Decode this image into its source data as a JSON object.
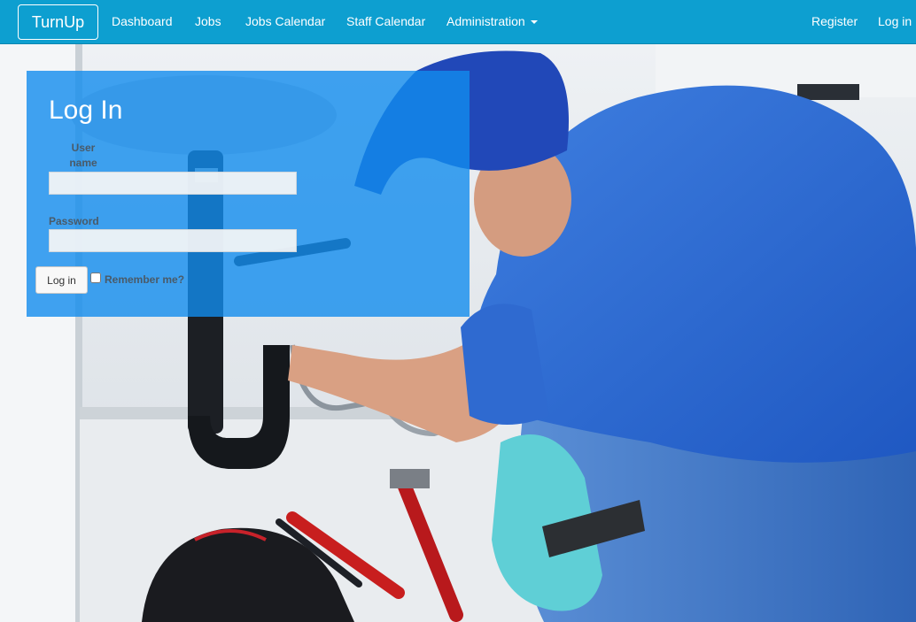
{
  "navbar": {
    "brand": "TurnUp",
    "links": {
      "dashboard": "Dashboard",
      "jobs": "Jobs",
      "jobs_calendar": "Jobs Calendar",
      "staff_calendar": "Staff Calendar",
      "administration": "Administration"
    },
    "register": "Register",
    "login": "Log in"
  },
  "login_form": {
    "title": "Log In",
    "username_label": "User name",
    "username_value": "",
    "password_label": "Password",
    "password_value": "",
    "submit_label": "Log in",
    "remember_label": "Remember me?",
    "remember_checked": false
  },
  "colors": {
    "navbar": "#0d9fd0",
    "panel": "#128cee",
    "background_scene": "#e4e8ec"
  }
}
